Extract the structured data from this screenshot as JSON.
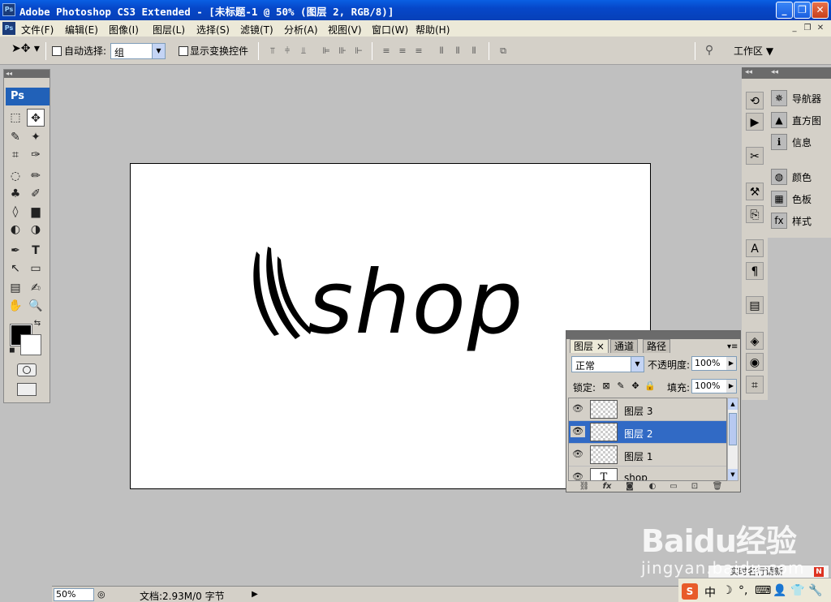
{
  "window": {
    "title": "Adobe Photoshop CS3 Extended - [未标题-1 @ 50% (图层 2, RGB/8)]",
    "app_icon": "Ps",
    "controls": {
      "minimize": "_",
      "restore": "❐",
      "close": "✕"
    }
  },
  "menu": {
    "items": [
      "文件(F)",
      "编辑(E)",
      "图像(I)",
      "图层(L)",
      "选择(S)",
      "滤镜(T)",
      "分析(A)",
      "视图(V)",
      "窗口(W)",
      "帮助(H)"
    ],
    "mdi_controls": [
      "_",
      "❐",
      "✕"
    ]
  },
  "options": {
    "auto_select_label": "自动选择:",
    "auto_select_value": "组",
    "show_transform_label": "显示变换控件",
    "workspace_label": "工作区 ▼"
  },
  "tools": {
    "header": "◂◂",
    "logo": "Ps",
    "items": [
      "⬚",
      "✥",
      "✎",
      "✦",
      "⌗",
      "✑",
      "◌",
      "✏",
      "♣",
      "✐",
      "◊",
      "▆",
      "◐",
      "◑",
      "✒",
      "T",
      "↖",
      "▭",
      "▤",
      "✍",
      "✋",
      "🔍"
    ]
  },
  "document": {
    "text": "shop"
  },
  "right_panels": {
    "items": [
      "导航器",
      "直方图",
      "信息",
      "颜色",
      "色板",
      "样式"
    ]
  },
  "layers_panel": {
    "tabs": [
      "图层 ×",
      "通道",
      "路径"
    ],
    "blend_mode": "正常",
    "opacity_label": "不透明度:",
    "opacity_value": "100%",
    "lock_label": "锁定:",
    "fill_label": "填充:",
    "fill_value": "100%",
    "layers": [
      {
        "name": "图层 3",
        "type": "raster",
        "selected": false
      },
      {
        "name": "图层 2",
        "type": "raster",
        "selected": true
      },
      {
        "name": "图层 1",
        "type": "raster",
        "selected": false
      },
      {
        "name": "shop",
        "type": "text",
        "selected": false
      }
    ],
    "text_thumb": "T"
  },
  "status": {
    "zoom": "50%",
    "doc_info": "文档:2.93M/0 字节"
  },
  "tray": {
    "badge": "S",
    "items": [
      "中",
      "☽",
      "°,",
      "⌨",
      "👤",
      "👕",
      "🔧"
    ],
    "ticker": "实时名行请新"
  },
  "watermark": {
    "brand": "Baidu经验",
    "url": "jingyan.baidu.com"
  },
  "colors": {
    "title_blue": "#0647c9",
    "selection_blue": "#316ac5",
    "panel_gray": "#d4d0c8",
    "canvas_gray": "#c0c0c0"
  }
}
